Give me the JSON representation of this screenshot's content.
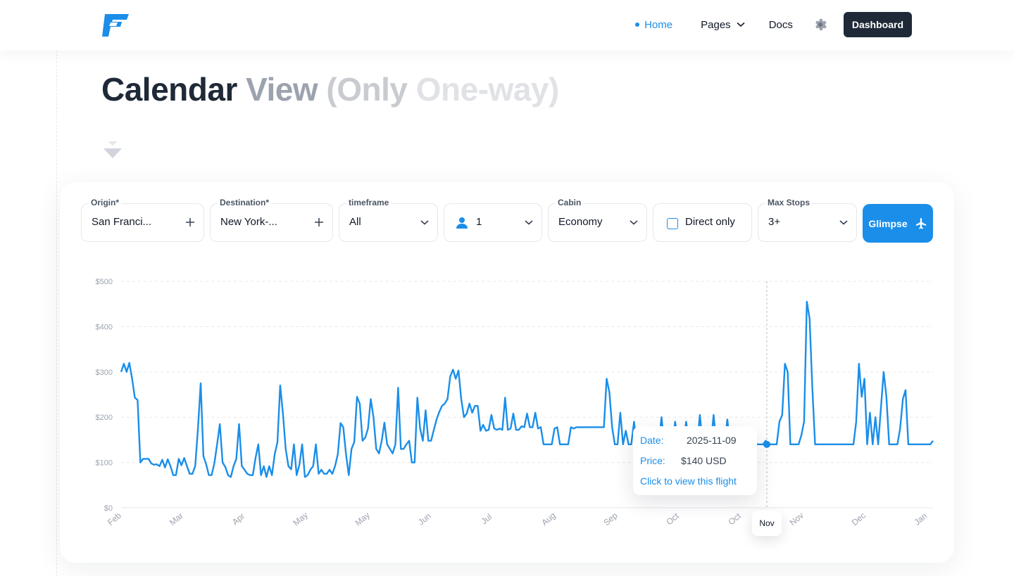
{
  "nav": {
    "home": "Home",
    "pages": "Pages",
    "docs": "Docs",
    "dashboard": "Dashboard",
    "icons": {
      "logo": "plane-logo-icon",
      "theme": "gear-icon",
      "dropdown": "chevron-down-icon"
    }
  },
  "page": {
    "title_1": "Calendar",
    "title_2": "View",
    "title_3": "(Only",
    "title_4": "One-way)"
  },
  "form": {
    "origin": {
      "label": "Origin*",
      "value": "San Franci..."
    },
    "destination": {
      "label": "Destination*",
      "value": "New York-..."
    },
    "timeframe": {
      "label": "timeframe",
      "value": "All"
    },
    "passengers": {
      "value": "1"
    },
    "cabin": {
      "label": "Cabin",
      "value": "Economy"
    },
    "direct": {
      "label": "Direct only",
      "checked": false
    },
    "max_stops": {
      "label": "Max Stops",
      "value": "3+"
    },
    "submit": "Glimpse"
  },
  "tooltip": {
    "date_key": "Date:",
    "date_value": "2025-11-09",
    "price_key": "Price:",
    "price_value": "$140 USD",
    "link": "Click to view this flight"
  },
  "hover_label": "Nov",
  "colors": {
    "accent": "#1a8ee9",
    "dark": "#1f2937",
    "muted": "#9ca3af"
  },
  "chart_data": {
    "type": "line",
    "title": "",
    "xlabel": "",
    "ylabel": "",
    "ylim": [
      0,
      500
    ],
    "y_ticks": [
      "$0",
      "$100",
      "$200",
      "$300",
      "$400",
      "$500"
    ],
    "x_ticks": [
      "Feb",
      "Mar",
      "Apr",
      "May",
      "May",
      "Jun",
      "Jul",
      "Aug",
      "Sep",
      "Oct",
      "Oct",
      "Nov",
      "Dec",
      "Jan"
    ],
    "hover": {
      "date": "2025-11-09",
      "value": 140
    },
    "grid": true,
    "series": [
      {
        "values": [
          300,
          318,
          300,
          320,
          285,
          243,
          238,
          100,
          108,
          108,
          108,
          98,
          95,
          96,
          92,
          106,
          89,
          107,
          92,
          72,
          72,
          108,
          94,
          110,
          92,
          75,
          75,
          92,
          174,
          275,
          114,
          96,
          72,
          72,
          98,
          140,
          185,
          100,
          90,
          72,
          68,
          92,
          108,
          185,
          92,
          84,
          75,
          72,
          72,
          110,
          140,
          72,
          92,
          68,
          92,
          72,
          118,
          145,
          270,
          208,
          130,
          92,
          85,
          140,
          72,
          95,
          140,
          68,
          72,
          84,
          92,
          140,
          75,
          84,
          75,
          75,
          84,
          75,
          92,
          118,
          187,
          178,
          118,
          72,
          130,
          145,
          245,
          230,
          148,
          155,
          175,
          240,
          200,
          130,
          120,
          148,
          188,
          140,
          130,
          120,
          140,
          265,
          130,
          130,
          140,
          148,
          100,
          100,
          243,
          175,
          148,
          215,
          148,
          148,
          172,
          195,
          212,
          225,
          230,
          240,
          290,
          305,
          285,
          303,
          240,
          200,
          208,
          230,
          210,
          225,
          225,
          170,
          183,
          170,
          172,
          205,
          175,
          172,
          175,
          172,
          243,
          172,
          175,
          208,
          172,
          172,
          180,
          178,
          208,
          178,
          178,
          210,
          175,
          178,
          140,
          140,
          140,
          140,
          175,
          178,
          140,
          140,
          140,
          140,
          178,
          175,
          178,
          178,
          178,
          178,
          178,
          178,
          178,
          178,
          178,
          178,
          178,
          285,
          255,
          178,
          140,
          140,
          210,
          140,
          170,
          140,
          140,
          190,
          140,
          140,
          140,
          140,
          178,
          178,
          140,
          140,
          140,
          200,
          140,
          140,
          140,
          140,
          190,
          140,
          140,
          140,
          190,
          140,
          140,
          140,
          140,
          205,
          140,
          140,
          140,
          140,
          205,
          140,
          140,
          140,
          140,
          195,
          140,
          140,
          140,
          140,
          140,
          140,
          140,
          140,
          140,
          140,
          140,
          140,
          140,
          148,
          140,
          140,
          140,
          140,
          190,
          205,
          318,
          300,
          140,
          140,
          140,
          140,
          160,
          190,
          455,
          418,
          265,
          140,
          140,
          140,
          140,
          140,
          140,
          140,
          140,
          140,
          140,
          140,
          140,
          140,
          140,
          140,
          190,
          318,
          245,
          285,
          140,
          210,
          140,
          200,
          140,
          220,
          300,
          245,
          140,
          140,
          140,
          140,
          175,
          240,
          260,
          140,
          140,
          140,
          140,
          140,
          140,
          140,
          140,
          140,
          148
        ]
      }
    ]
  }
}
